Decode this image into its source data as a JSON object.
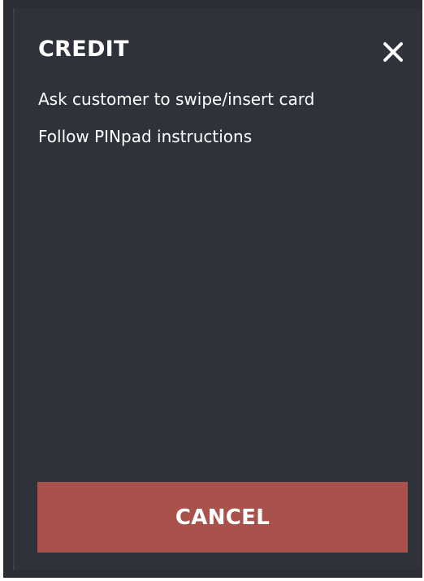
{
  "dialog": {
    "title": "CREDIT",
    "close_icon": "close-icon",
    "instructions": [
      "Ask customer to swipe/insert card",
      "Follow PINpad instructions"
    ],
    "cancel_label": "CANCEL"
  },
  "colors": {
    "background": "#2f323a",
    "cancel_button": "#a8524b",
    "text": "#ffffff"
  }
}
